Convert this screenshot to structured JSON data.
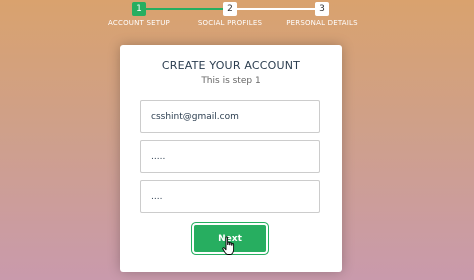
{
  "progress": {
    "steps": [
      {
        "number": "1",
        "label": "ACCOUNT SETUP",
        "active": true
      },
      {
        "number": "2",
        "label": "SOCIAL PROFILES",
        "active": false
      },
      {
        "number": "3",
        "label": "PERSONAL DETAILS",
        "active": false
      }
    ]
  },
  "form": {
    "title": "CREATE YOUR ACCOUNT",
    "subtitle": "This is step 1",
    "email_value": "csshint@gmail.com",
    "password_value": ".....",
    "confirm_password_value": "....",
    "next_label": "Next"
  },
  "colors": {
    "accent": "#27ae60",
    "card": "#ffffff",
    "background_top": "#d9a26e",
    "background_bottom": "#c99aac"
  }
}
